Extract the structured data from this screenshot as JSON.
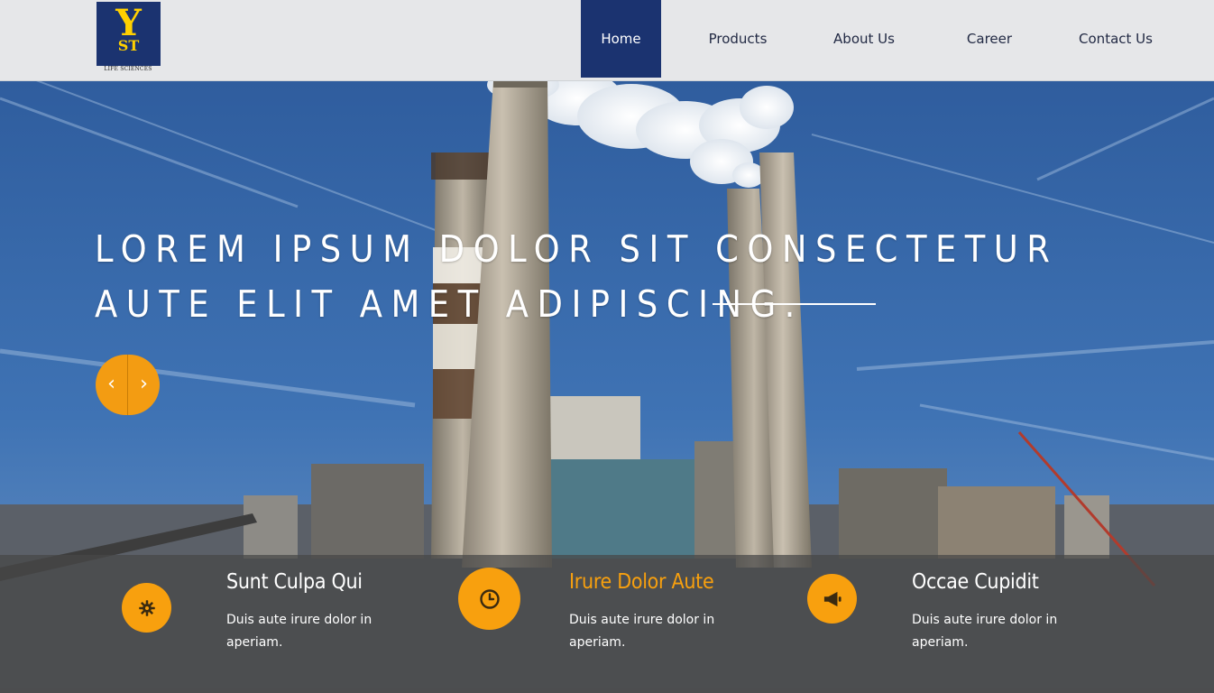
{
  "brand": {
    "logo_top": "Y",
    "logo_bottom": "ST",
    "logo_caption": "LIFE SCIENCES",
    "colors": {
      "navy": "#1b3370",
      "gold": "#ffd000"
    }
  },
  "nav": {
    "items": [
      {
        "label": "Home",
        "active": true
      },
      {
        "label": "Products",
        "active": false
      },
      {
        "label": "About Us",
        "active": false
      },
      {
        "label": "Career",
        "active": false
      },
      {
        "label": "Contact Us",
        "active": false
      }
    ]
  },
  "hero": {
    "headline_line1": "LOREM IPSUM DOLOR SIT CONSECTETUR",
    "headline_line2": "AUTE ELIT AMET ADIPISCING.",
    "prev_icon": "‹",
    "next_icon": "›",
    "icons": {
      "prev": "chevron-left-icon",
      "next": "chevron-right-icon"
    },
    "accent_color": "#f39c12"
  },
  "features": [
    {
      "icon": "gear-icon",
      "title": "Sunt Culpa Qui",
      "text": "Duis aute irure dolor in aperiam.",
      "highlighted": false
    },
    {
      "icon": "clock-icon",
      "title": "Irure Dolor Aute",
      "text": "Duis aute irure dolor in aperiam.",
      "highlighted": true
    },
    {
      "icon": "megaphone-icon",
      "title": "Occae Cupidit",
      "text": "Duis aute irure dolor in aperiam.",
      "highlighted": false
    }
  ]
}
